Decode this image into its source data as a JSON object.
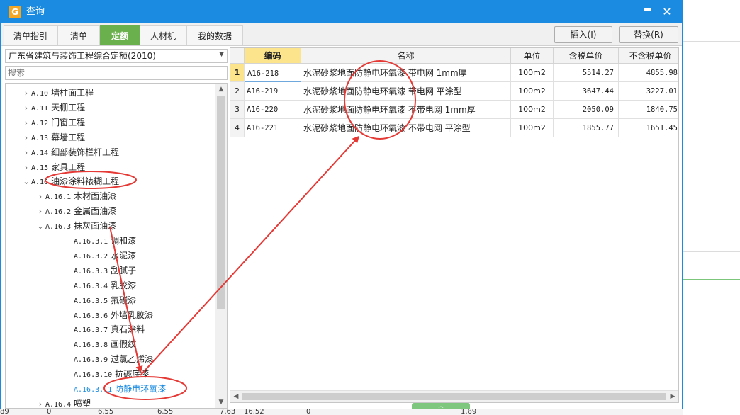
{
  "window": {
    "title": "查询",
    "app_icon_glyph": "G"
  },
  "tabs": [
    {
      "label": "清单指引"
    },
    {
      "label": "清单"
    },
    {
      "label": "定额",
      "active": true
    },
    {
      "label": "人材机"
    },
    {
      "label": "我的数据"
    }
  ],
  "toolbar": {
    "insert_label": "插入(I)",
    "replace_label": "替换(R)"
  },
  "left": {
    "quota_set": "广东省建筑与装饰工程综合定额(2010)",
    "search_placeholder": "搜索"
  },
  "tree": [
    {
      "code": "A.10",
      "label": "墙柱面工程",
      "chev": "›"
    },
    {
      "code": "A.11",
      "label": "天棚工程",
      "chev": "›"
    },
    {
      "code": "A.12",
      "label": "门窗工程",
      "chev": "›"
    },
    {
      "code": "A.13",
      "label": "幕墙工程",
      "chev": "›"
    },
    {
      "code": "A.14",
      "label": "细部装饰栏杆工程",
      "chev": "›"
    },
    {
      "code": "A.15",
      "label": "家具工程",
      "chev": "›"
    },
    {
      "code": "A.16",
      "label": "油漆涂料裱糊工程",
      "chev": "⌄"
    },
    {
      "code": "A.16.1",
      "label": "木材面油漆",
      "chev": "›"
    },
    {
      "code": "A.16.2",
      "label": "金属面油漆",
      "chev": "›"
    },
    {
      "code": "A.16.3",
      "label": "抹灰面油漆",
      "chev": "⌄"
    },
    {
      "code": "A.16.3.1",
      "label": "调和漆",
      "chev": ""
    },
    {
      "code": "A.16.3.2",
      "label": "水泥漆",
      "chev": ""
    },
    {
      "code": "A.16.3.3",
      "label": "刮腻子",
      "chev": ""
    },
    {
      "code": "A.16.3.4",
      "label": "乳胶漆",
      "chev": ""
    },
    {
      "code": "A.16.3.5",
      "label": "氟碳漆",
      "chev": ""
    },
    {
      "code": "A.16.3.6",
      "label": "外墙乳胶漆",
      "chev": ""
    },
    {
      "code": "A.16.3.7",
      "label": "真石涂料",
      "chev": ""
    },
    {
      "code": "A.16.3.8",
      "label": "画假纹",
      "chev": ""
    },
    {
      "code": "A.16.3.9",
      "label": "过氯乙烯漆",
      "chev": ""
    },
    {
      "code": "A.16.3.10",
      "label": "抗碱底漆",
      "chev": ""
    },
    {
      "code": "A.16.3.11",
      "label": "防静电环氧漆",
      "chev": "",
      "selected": true
    },
    {
      "code": "A.16.4",
      "label": "喷塑",
      "chev": "›"
    }
  ],
  "grid": {
    "headers": [
      "编码",
      "名称",
      "单位",
      "含税单价",
      "不含税单价"
    ],
    "rows": [
      {
        "num": "1",
        "code": "A16-218",
        "name": "水泥砂浆地面防静电环氧漆 带电网 1mm厚",
        "unit": "100m2",
        "price_tax": "5514.27",
        "price_notax": "4855.98"
      },
      {
        "num": "2",
        "code": "A16-219",
        "name": "水泥砂浆地面防静电环氧漆 带电网 平涂型",
        "unit": "100m2",
        "price_tax": "3647.44",
        "price_notax": "3227.01"
      },
      {
        "num": "3",
        "code": "A16-220",
        "name": "水泥砂浆地面防静电环氧漆 不带电网 1mm厚",
        "unit": "100m2",
        "price_tax": "2050.09",
        "price_notax": "1840.75"
      },
      {
        "num": "4",
        "code": "A16-221",
        "name": "水泥砂浆地面防静电环氧漆 不带电网 平涂型",
        "unit": "100m2",
        "price_tax": "1855.77",
        "price_notax": "1651.45"
      }
    ]
  },
  "background_values": [
    "89",
    "0",
    "6.55",
    "6.55",
    "7.63",
    "16.52",
    "0",
    "1.89"
  ],
  "colors": {
    "titlebar": "#1a8be0",
    "active_tab": "#6ab04c",
    "header_highlight": "#fce48d",
    "annotation": "#e53935"
  }
}
